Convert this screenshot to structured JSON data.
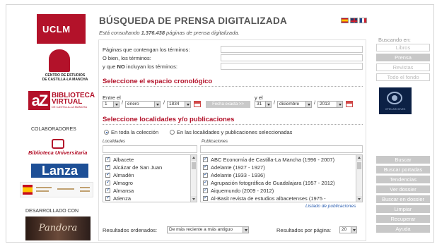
{
  "header": {
    "title": "BÚSQUEDA DE PRENSA DIGITALIZADA",
    "subtitle_prefix": "Está consultando",
    "subtitle_count": "1.376.438",
    "subtitle_suffix": "páginas de prensa digitalizada."
  },
  "logos": {
    "uclm": "UCLM",
    "ce_line1": "CENTRO DE ESTUDIOS",
    "ce_line2": "DE CASTILLA-LA MANCHA",
    "bv_line1": "BIBLIOTECA",
    "bv_line2": "VIRTUAL",
    "bv_line3": "DE CASTILLA-LA MANCHA",
    "colab_label": "COLABORADORES",
    "bu_text": "Biblioteca Universitaria",
    "lanza": "Lanza",
    "dev_label": "DESARROLLADO CON",
    "pandora": "Pandora",
    "open_archives": "OPEN ARCHIVES"
  },
  "search_terms": {
    "contain_label": "Páginas que contengan los términos:",
    "or_label": "O bien, los términos:",
    "not_prefix": "y que",
    "not_bold": "NO",
    "not_suffix": "incluyan los términos:",
    "contain_value": "",
    "or_value": "",
    "not_value": ""
  },
  "chrono": {
    "section_title": "Seleccione el espacio cronológico",
    "between_label": "Entre el",
    "and_label": "y el",
    "from_day": "1",
    "from_month": "enero",
    "from_year": "1834",
    "exact_date_button": "Fecha exacta",
    "to_day": "31",
    "to_month": "diciembre",
    "to_year": "2013"
  },
  "localities": {
    "section_title": "Seleccione localidades y/o publicaciones",
    "radio_all": "En toda la colección",
    "radio_selected": "En las localidades y publicaciones seleccionadas",
    "localities_header": "Localidades",
    "publications_header": "Publicaciones",
    "localities": [
      "Albacete",
      "Alcázar de San Juan",
      "Almadén",
      "Almagro",
      "Almansa",
      "Atienza"
    ],
    "publications": [
      "ABC Economía de Castilla-La Mancha (1996 - 2007)",
      "Adelante (1927 - 1927)",
      "Adelante (1933 - 1936)",
      "Agrupación fotográfica de Guadalajara (1957 - 2012)",
      "Aiquemundo (2009 - 2012)",
      "Al-Basit revista de estudios albacetenses (1975 -"
    ],
    "publications_link": "Listado de publicaciones"
  },
  "results": {
    "order_label": "Resultados ordenados:",
    "order_value": "De más reciente a más antiguo",
    "per_page_label": "Resultados por página:",
    "per_page_value": "20"
  },
  "right_panel": {
    "searching_label": "Buscando en:",
    "targets": [
      "Libros",
      "Prensa",
      "Revistas",
      "Todo el fondo"
    ],
    "actions": [
      "Buscar",
      "Buscar portadas",
      "Tendencias",
      "Ver dossier",
      "Buscar en dossier",
      "Limpiar",
      "Recuperar",
      "Ayuda"
    ]
  }
}
